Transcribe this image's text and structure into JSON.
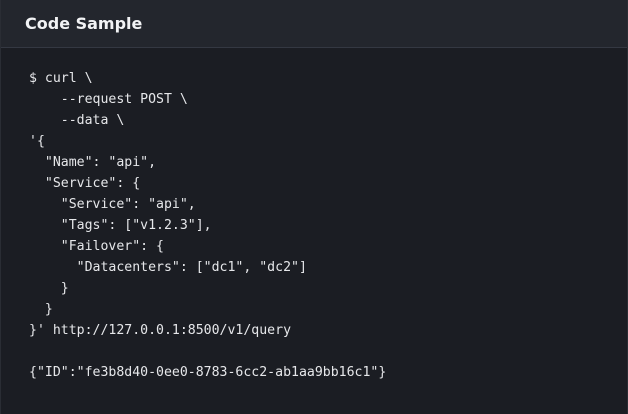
{
  "header": {
    "title": "Code Sample"
  },
  "code": {
    "lines": [
      "$ curl \\",
      "    --request POST \\",
      "    --data \\",
      "'{",
      "  \"Name\": \"api\",",
      "  \"Service\": {",
      "    \"Service\": \"api\",",
      "    \"Tags\": [\"v1.2.3\"],",
      "    \"Failover\": {",
      "      \"Datacenters\": [\"dc1\", \"dc2\"]",
      "    }",
      "  }",
      "}' http://127.0.0.1:8500/v1/query",
      "",
      "{\"ID\":\"fe3b8d40-0ee0-8783-6cc2-ab1aa9bb16c1\"}"
    ]
  },
  "colors": {
    "background": "#1b1d23",
    "header_background": "#23262d",
    "text": "#e6e7ea"
  }
}
